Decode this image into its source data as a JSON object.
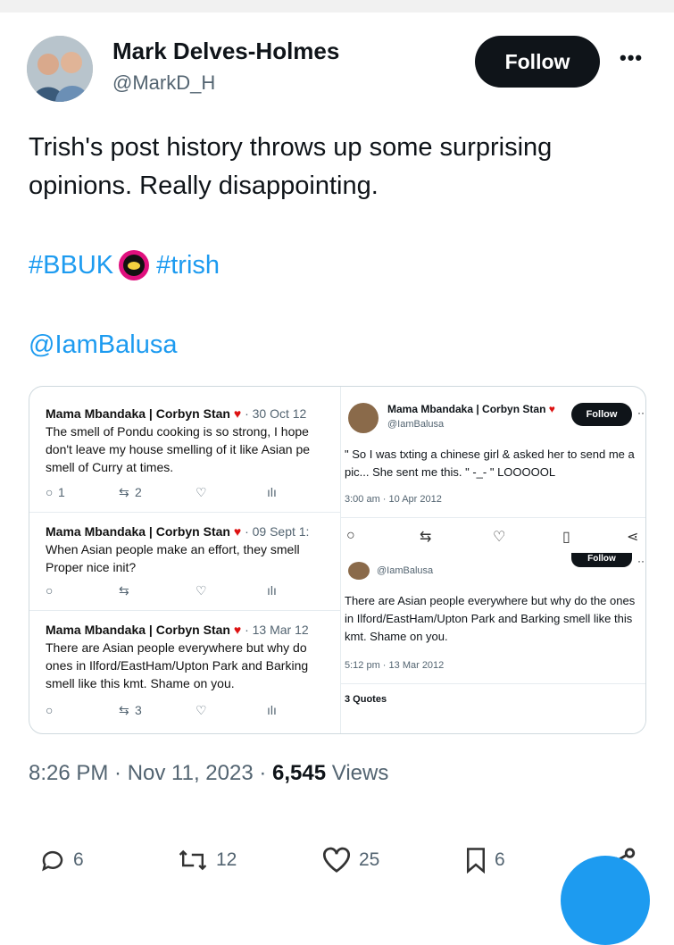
{
  "header": {
    "display_name": "Mark Delves-Holmes",
    "handle": "@MarkD_H",
    "follow_label": "Follow",
    "more_label": "•••"
  },
  "tweet": {
    "text": "Trish's post history throws up some surprising opinions. Really disappointing.",
    "hashtag1": "#BBUK",
    "hashtag2": "#trish",
    "mention": "@IamBalusa"
  },
  "embedded_left": {
    "tweets": [
      {
        "author": "Mama Mbandaka | Corbyn Stan",
        "date": "· 30 Oct 12",
        "lines": [
          "The smell of Pondu cooking is so strong, I hope",
          "don't leave my house smelling of it like Asian pe",
          "smell of Curry at times."
        ],
        "reply": "1",
        "retweet": "2",
        "like": "",
        "views": ""
      },
      {
        "author": "Mama Mbandaka | Corbyn Stan",
        "date": "· 09 Sept 1:",
        "lines": [
          "When Asian people make an effort, they smell",
          "Proper nice init?"
        ],
        "reply": "",
        "retweet": "",
        "like": "",
        "views": ""
      },
      {
        "author": "Mama Mbandaka | Corbyn Stan",
        "date": "· 13 Mar 12",
        "lines": [
          "There are Asian people everywhere but why do",
          "ones in Ilford/EastHam/Upton Park and Barking",
          "smell like this kmt. Shame on you."
        ],
        "reply": "",
        "retweet": "3",
        "like": "",
        "views": ""
      }
    ]
  },
  "embedded_right": {
    "author": "Mama Mbandaka | Corbyn Stan",
    "handle": "@IamBalusa",
    "follow_label": "Follow",
    "more_label": "···",
    "text": "\" So I was txting a chinese girl & asked her to send me a pic... She sent me this. \" -_- \" LOOOOOL",
    "meta": "3:00 am · 10 Apr 2012",
    "inner": {
      "handle": "@IamBalusa",
      "follow_label": "Follow",
      "more_label": "···",
      "text": "There are Asian people everywhere but why do the ones in Ilford/EastHam/Upton Park and Barking smell like this kmt. Shame on you.",
      "meta": "5:12 pm · 13 Mar 2012",
      "quotes": "3 Quotes"
    }
  },
  "footer": {
    "time": "8:26 PM · Nov 11, 2023 · ",
    "views_count": "6,545",
    "views_label": " Views"
  },
  "actions": {
    "replies": "6",
    "retweets": "12",
    "likes": "25",
    "bookmarks": "6"
  },
  "colors": {
    "link": "#1d9bf0",
    "follow_bg": "#0f1419",
    "muted": "#536471"
  }
}
